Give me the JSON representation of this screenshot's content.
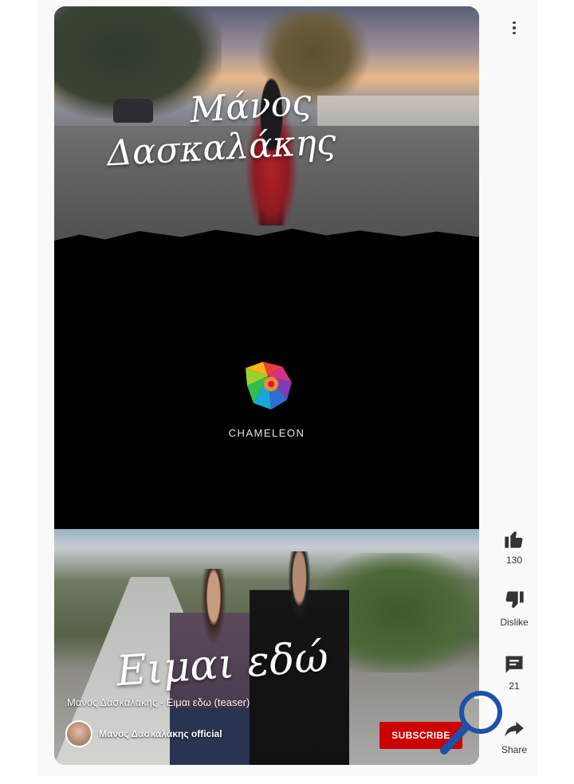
{
  "video": {
    "overlay_name_line1": "Μάνος",
    "overlay_name_line2": "Δασκαλάκης",
    "brand_name": "CHAMELEON",
    "overlay_song_title": "Ειμαι εδώ",
    "title": "Μανος Δασκαλακης - Ειμαι εδω (teaser)",
    "channel_name": "Μανος Δασκαλάκης official",
    "subscribe_label": "SUBSCRIBE"
  },
  "actions": {
    "like_count": "130",
    "dislike_label": "Dislike",
    "comment_count": "21",
    "share_label": "Share"
  },
  "icons": {
    "more": "more-vertical-icon",
    "like": "thumbs-up-icon",
    "dislike": "thumbs-down-icon",
    "comment": "comment-icon",
    "share": "share-icon",
    "magnifier": "magnifier-icon",
    "logo": "chameleon-logo"
  },
  "colors": {
    "subscribe": "#cc0000",
    "magnifier": "#1f4fa8",
    "action_icon": "#333333"
  }
}
